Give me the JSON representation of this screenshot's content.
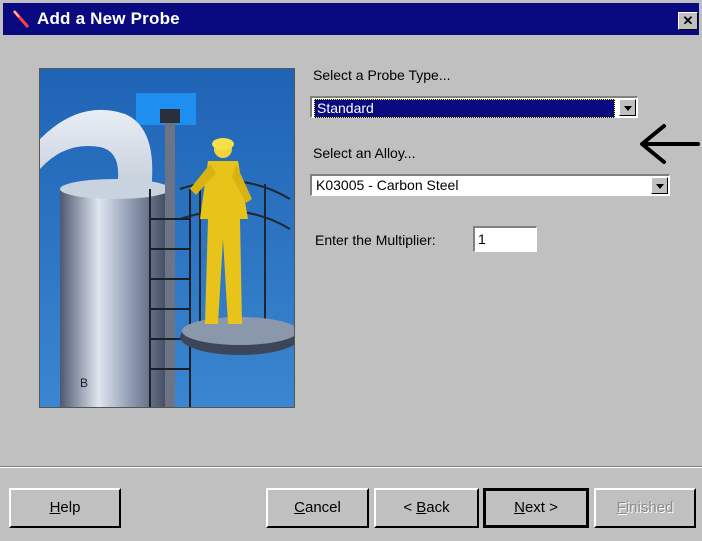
{
  "window": {
    "title": "Add a New Probe",
    "close_label": "✕"
  },
  "form": {
    "probe_type_label": "Select a Probe Type...",
    "probe_type_value": "Standard",
    "alloy_label": "Select an Alloy...",
    "alloy_value": "K03005 - Carbon Steel",
    "multiplier_label": "Enter the Multiplier:",
    "multiplier_value": "1"
  },
  "buttons": {
    "help": {
      "mnemonic": "H",
      "rest": "elp"
    },
    "cancel": {
      "mnemonic": "C",
      "rest": "ancel"
    },
    "back": {
      "prefix": "< ",
      "mnemonic": "B",
      "rest": "ack"
    },
    "next": {
      "mnemonic": "N",
      "rest": "ext >"
    },
    "finished": {
      "mnemonic": "F",
      "rest": "inished"
    }
  },
  "colors": {
    "title_bar": "#0a0a80",
    "dialog_face": "#c0c0c0",
    "selection": "#0a0a80"
  }
}
